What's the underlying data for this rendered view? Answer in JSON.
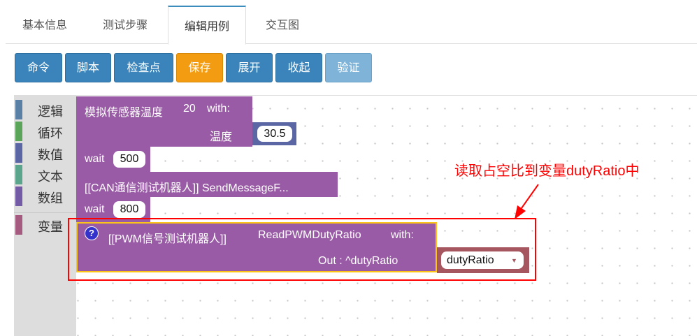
{
  "tabs": [
    {
      "label": "基本信息"
    },
    {
      "label": "测试步骤"
    },
    {
      "label": "编辑用例"
    },
    {
      "label": "交互图"
    }
  ],
  "toolbar": {
    "command": "命令",
    "script": "脚本",
    "checkpoint": "检查点",
    "save": "保存",
    "expand": "展开",
    "collapse": "收起",
    "verify": "验证"
  },
  "toolbox": [
    {
      "label": "逻辑",
      "color": "#5b80a5"
    },
    {
      "label": "循环",
      "color": "#5ba55b"
    },
    {
      "label": "数值",
      "color": "#5b67a5"
    },
    {
      "label": "文本",
      "color": "#5ba58c"
    },
    {
      "label": "数组",
      "color": "#745ba5"
    },
    {
      "label": "变量",
      "color": "#a55b80"
    }
  ],
  "blocks": {
    "sensor": {
      "title": "模拟传感器温度",
      "value": "20",
      "with": "with:",
      "param": "温度",
      "param_value": "30.5"
    },
    "wait1": {
      "label": "wait",
      "value": "500"
    },
    "can": {
      "text": "[[CAN通信测试机器人]] SendMessageF..."
    },
    "wait2": {
      "label": "wait",
      "value": "800"
    },
    "pwm": {
      "help": "?",
      "title": "[[PWM信号测试机器人]]",
      "method": "ReadPWMDutyRatio",
      "with": "with:",
      "out_label": "Out : ^dutyRatio",
      "var": "dutyRatio"
    }
  },
  "annotation": {
    "text": "读取占空比到变量dutyRatio中"
  },
  "colors": {
    "block_purple": "#995ba5",
    "accent_blue": "#3a84bb",
    "save_orange": "#f39c12",
    "annotation_red": "#ff0000"
  }
}
